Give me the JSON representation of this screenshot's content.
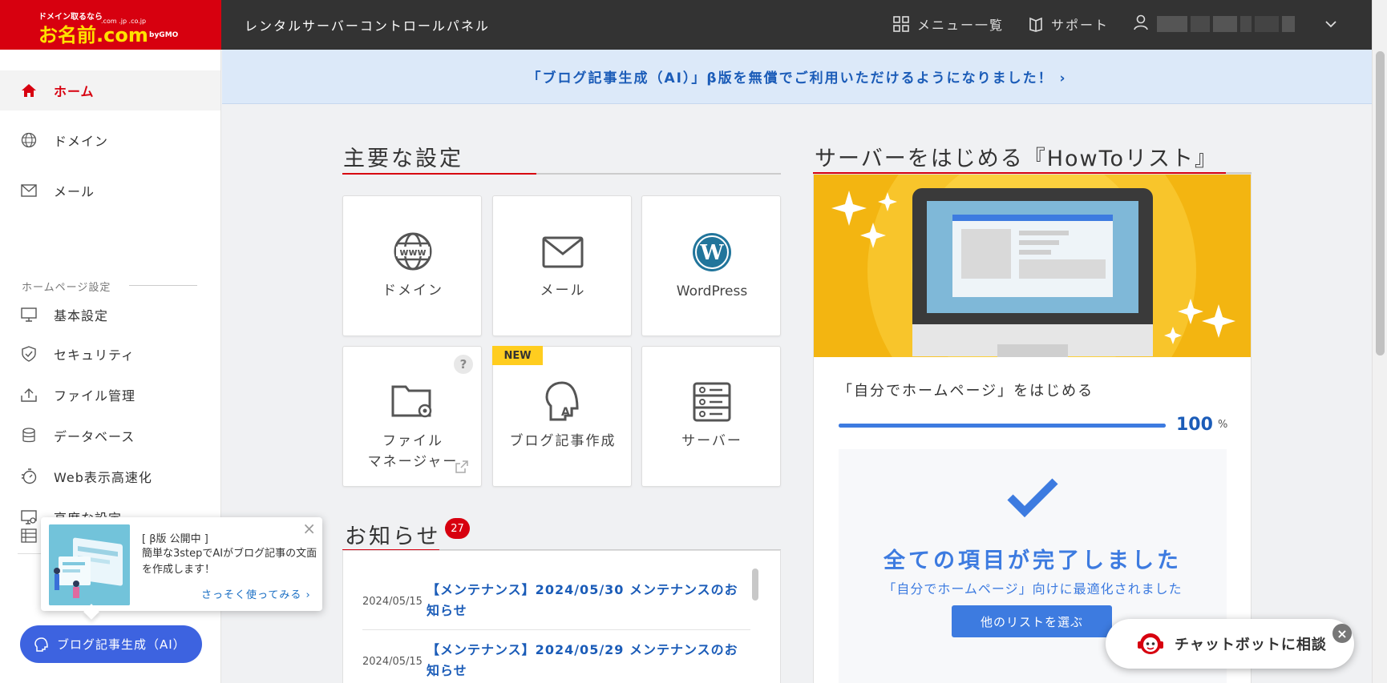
{
  "brand": {
    "logo_top": "ドメイン取るなら",
    "logo_main": "お名前.com",
    "logo_domains": ".com .jp .co.jp",
    "logo_gmo": "byGMO",
    "app_title": "レンタルサーバーコントロールパネル",
    "red": "#d7000f"
  },
  "topnav": {
    "menu_label": "メニュー一覧",
    "support_label": "サポート"
  },
  "sidebar": {
    "home": "ホーム",
    "domain": "ドメイン",
    "mail": "メール",
    "section_label": "ホームページ設定",
    "basic": "基本設定",
    "security": "セキュリティ",
    "file": "ファイル管理",
    "database": "データベース",
    "speed": "Web表示高速化",
    "advanced": "高度な設定"
  },
  "popup": {
    "title": "[ β版 公開中 ]",
    "body": "簡単な3stepでAIがブログ記事の文面を作成します！",
    "link": "さっそく使ってみる ›",
    "close": "×"
  },
  "ai_button": "ブログ記事生成（AI）",
  "banner": "「ブログ記事生成（AI）」β版を無償でご利用いただけるようになりました！ ›",
  "main_settings": {
    "title": "主要な設定",
    "tiles": {
      "domain": "ドメイン",
      "mail": "メール",
      "wordpress": "WordPress",
      "file_manager_1": "ファイル",
      "file_manager_2": "マネージャー",
      "blog": "ブログ記事作成",
      "server": "サーバー",
      "new_badge": "NEW",
      "help": "?"
    }
  },
  "news": {
    "title": "お知らせ",
    "count": "27",
    "items": [
      {
        "date": "2024/05/15",
        "title": "【メンテナンス】2024/05/30 メンテナンスのお知らせ"
      },
      {
        "date": "2024/05/15",
        "title": "【メンテナンス】2024/05/29 メンテナンスのお知らせ"
      }
    ]
  },
  "howto": {
    "title": "サーバーをはじめる『HowToリスト』",
    "subtitle": "「自分でホームページ」をはじめる",
    "progress": 100,
    "progress_value": "100",
    "progress_unit": "%",
    "done_title": "全ての項目が完了しました",
    "done_note": "「自分でホームページ」向けに最適化されました",
    "button": "他のリストを選ぶ"
  },
  "chatbot": {
    "label": "チャットボットに相談",
    "close": "×"
  }
}
